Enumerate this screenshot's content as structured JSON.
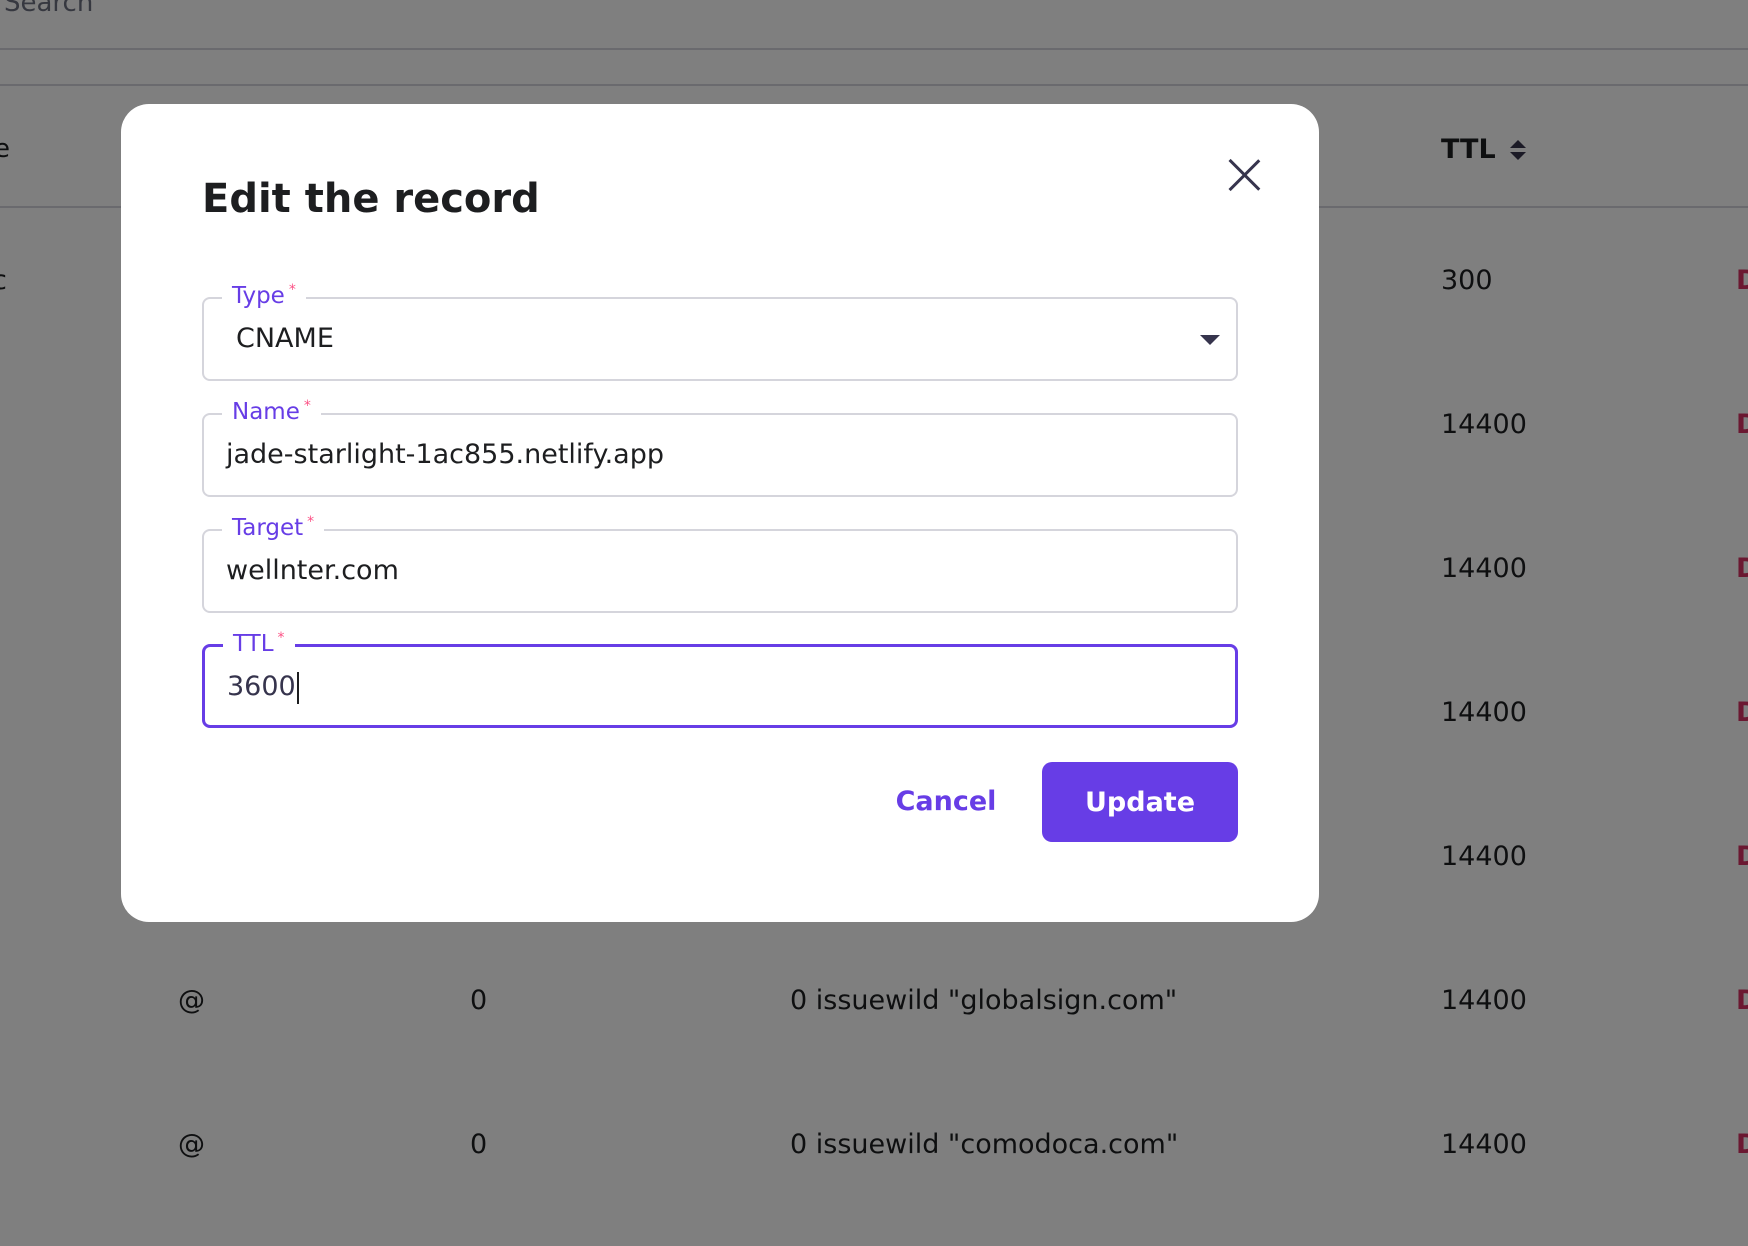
{
  "background": {
    "search_placeholder": "Search",
    "table": {
      "header_ttl": "TTL",
      "rows": [
        {
          "name": "",
          "priority": "",
          "content": "",
          "ttl": "300",
          "action": "D"
        },
        {
          "name": "",
          "priority": "",
          "content": "",
          "ttl": "14400",
          "action": "D"
        },
        {
          "name": "",
          "priority": "",
          "content": "",
          "ttl": "14400",
          "action": "D"
        },
        {
          "name": "",
          "priority": "",
          "content": "",
          "ttl": "14400",
          "action": "D"
        },
        {
          "name": "",
          "priority": "",
          "content": "",
          "ttl": "14400",
          "action": "D"
        },
        {
          "name": "@",
          "priority": "0",
          "content": "0 issuewild \"globalsign.com\"",
          "ttl": "14400",
          "action": "D"
        },
        {
          "name": "@",
          "priority": "0",
          "content": "0 issuewild \"comodoca.com\"",
          "ttl": "14400",
          "action": "D"
        }
      ]
    }
  },
  "modal": {
    "title": "Edit the record",
    "fields": {
      "type": {
        "label": "Type",
        "required_mark": "*",
        "value": "CNAME"
      },
      "name": {
        "label": "Name",
        "required_mark": "*",
        "value": "jade-starlight-1ac855.netlify.app"
      },
      "target": {
        "label": "Target",
        "required_mark": "*",
        "value": "wellnter.com"
      },
      "ttl": {
        "label": "TTL",
        "required_mark": "*",
        "value": "3600"
      }
    },
    "cancel_label": "Cancel",
    "update_label": "Update"
  },
  "colors": {
    "accent": "#673de6",
    "required": "#fc5185",
    "danger": "#d63163",
    "overlay": "rgba(0,0,0,0.5)"
  }
}
